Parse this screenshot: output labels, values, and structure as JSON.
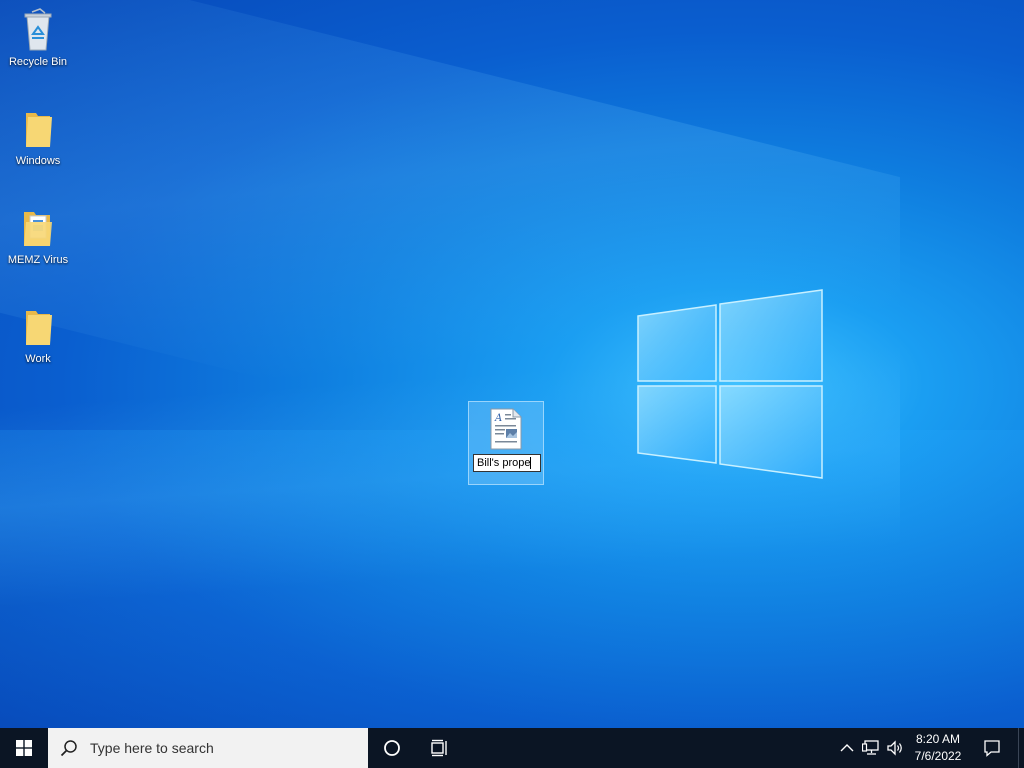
{
  "desktop": {
    "icons": [
      {
        "label": "Recycle Bin",
        "icon": "recycle-bin-icon"
      },
      {
        "label": "Windows",
        "icon": "folder-icon"
      },
      {
        "label": "MEMZ Virus",
        "icon": "folder-with-documents-icon"
      },
      {
        "label": "Work",
        "icon": "folder-icon"
      }
    ],
    "selected_file": {
      "icon": "rich-text-document-icon",
      "rename_value": "Bill's prope"
    }
  },
  "taskbar": {
    "search_placeholder": "Type here to search",
    "clock_time": "8:20 AM",
    "clock_date": "7/6/2022"
  },
  "colors": {
    "taskbar_bg": "#0b1524",
    "desktop_accent": "#1a9ef2",
    "search_bg": "#f2f2f2"
  }
}
